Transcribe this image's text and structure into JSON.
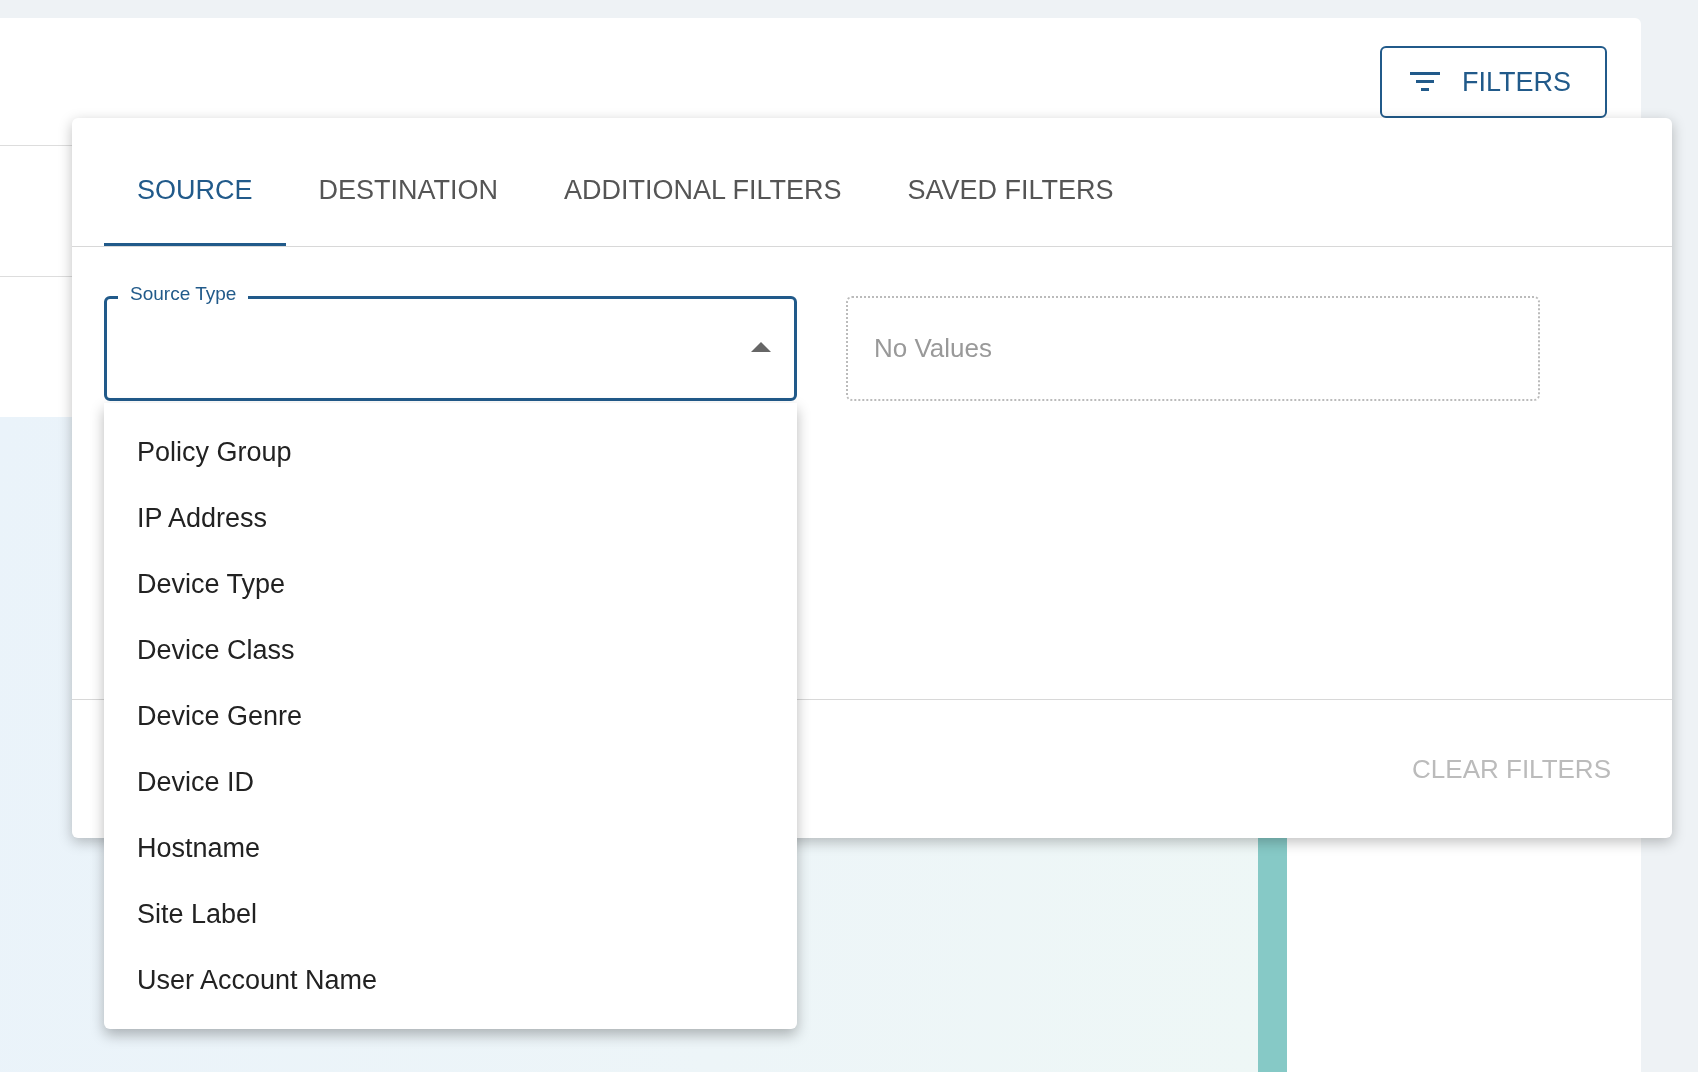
{
  "filters_button": {
    "label": "FILTERS"
  },
  "tabs": [
    {
      "label": "SOURCE",
      "selected": true
    },
    {
      "label": "DESTINATION",
      "selected": false
    },
    {
      "label": "ADDITIONAL FILTERS",
      "selected": false
    },
    {
      "label": "SAVED FILTERS",
      "selected": false
    }
  ],
  "source_type": {
    "label": "Source Type",
    "expanded": true,
    "options": [
      "Policy Group",
      "IP Address",
      "Device Type",
      "Device Class",
      "Device Genre",
      "Device ID",
      "Hostname",
      "Site Label",
      "User Account Name"
    ]
  },
  "values_field": {
    "placeholder": "No Values",
    "disabled": true
  },
  "clear_filters": {
    "label": "CLEAR FILTERS",
    "disabled": true
  }
}
